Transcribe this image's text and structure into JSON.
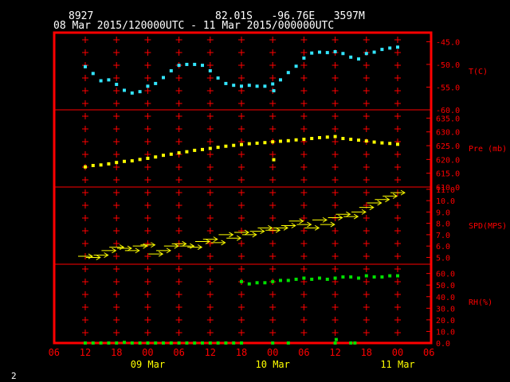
{
  "header": {
    "station": "8927",
    "location": "82.01S   -96.76E   3597M",
    "period": "08 Mar 2015/120000UTC - 11 Mar 2015/000000UTC"
  },
  "footer": {
    "page_number": "2"
  },
  "colors": {
    "background": "#000000",
    "frame": "#ff0000",
    "axis_text": "#ff0000",
    "header_text": "#ffffff",
    "date_text": "#ffff00",
    "temperature": "#33e5ff",
    "pressure": "#ffff00",
    "wind": "#ffff00",
    "humidity": "#00e000"
  },
  "x_axis": {
    "tick_labels": [
      "06",
      "12",
      "18",
      "00",
      "06",
      "12",
      "18",
      "00",
      "06",
      "12",
      "18",
      "00",
      "06"
    ],
    "tick_hours": [
      -6,
      0,
      6,
      12,
      18,
      24,
      30,
      36,
      42,
      48,
      54,
      60,
      66
    ],
    "date_labels": [
      {
        "text": "09 Mar",
        "hour": 12
      },
      {
        "text": "10 Mar",
        "hour": 36
      },
      {
        "text": "11 Mar",
        "hour": 60
      }
    ]
  },
  "chart_data": [
    {
      "type": "scatter",
      "panel": "temperature",
      "unit_label": "T(C)",
      "ylim": [
        -60,
        -43
      ],
      "y_ticks": [
        -45,
        -50,
        -55,
        -60
      ],
      "x_hours": [
        0,
        1.5,
        3,
        4.5,
        6,
        7.5,
        9,
        10.5,
        12,
        13.5,
        15,
        16.5,
        18,
        19.5,
        21,
        22.5,
        24,
        25.5,
        27,
        28.5,
        30,
        31.5,
        33,
        34.5,
        36,
        36.2,
        37.5,
        39,
        40.5,
        42,
        43.5,
        45,
        46.5,
        48,
        49.5,
        51,
        52.5,
        54,
        55.5,
        57,
        58.5,
        60
      ],
      "y": [
        -50.5,
        -52.0,
        -53.6,
        -53.4,
        -54.4,
        -55.7,
        -56.3,
        -56.0,
        -54.8,
        -54.2,
        -52.9,
        -51.4,
        -50.2,
        -50.0,
        -50.0,
        -50.2,
        -51.4,
        -53.0,
        -54.2,
        -54.6,
        -54.8,
        -54.6,
        -54.8,
        -54.8,
        -54.3,
        -55.8,
        -53.4,
        -51.8,
        -50.4,
        -48.6,
        -47.5,
        -47.3,
        -47.4,
        -47.2,
        -47.6,
        -48.4,
        -48.8,
        -47.6,
        -47.3,
        -46.7,
        -46.4,
        -46.2
      ]
    },
    {
      "type": "scatter",
      "panel": "pressure",
      "unit_label": "Pre (mb)",
      "ylim": [
        610,
        638
      ],
      "y_ticks": [
        635,
        630,
        625,
        620,
        615,
        610
      ],
      "x_hours": [
        0,
        1.5,
        3,
        4.5,
        6,
        7.5,
        9,
        10.5,
        12,
        13.5,
        15,
        16.5,
        18,
        19.5,
        21,
        22.5,
        24,
        25.5,
        27,
        28.5,
        30,
        31.5,
        33,
        34.5,
        36,
        36.2,
        37.5,
        39,
        40.5,
        42,
        43.5,
        45,
        46.5,
        48,
        49.5,
        51,
        52.5,
        54,
        55.5,
        57,
        58.5,
        60
      ],
      "y": [
        617.3,
        617.8,
        618.0,
        618.4,
        618.9,
        619.3,
        619.5,
        620.0,
        620.4,
        620.9,
        621.5,
        621.9,
        622.4,
        622.8,
        623.3,
        623.6,
        624.0,
        624.4,
        624.8,
        625.1,
        625.4,
        625.7,
        625.9,
        626.1,
        626.4,
        619.9,
        626.6,
        626.8,
        627.1,
        627.3,
        627.6,
        627.9,
        628.1,
        628.3,
        627.6,
        627.3,
        627.0,
        626.7,
        626.3,
        626.0,
        625.8,
        625.5
      ]
    },
    {
      "type": "wind",
      "panel": "wind_speed",
      "unit_label": "SPD(MPS)",
      "ylim": [
        4.4,
        11.2
      ],
      "y_ticks": [
        11,
        10,
        9,
        8,
        7,
        6,
        5
      ],
      "x_hours": [
        0,
        1.5,
        3,
        4.5,
        6,
        7.5,
        9,
        10.5,
        12,
        13.5,
        15,
        16.5,
        18,
        19.5,
        21,
        22.5,
        24,
        25.5,
        27,
        28.5,
        30,
        31.5,
        33,
        34.5,
        36,
        37.5,
        39,
        40.5,
        42,
        43.5,
        45,
        46.5,
        48,
        49.5,
        51,
        52.5,
        54,
        55.5,
        57,
        58.5,
        60
      ],
      "y": [
        5.1,
        5.0,
        5.2,
        5.6,
        5.9,
        5.8,
        5.6,
        6.0,
        6.1,
        5.3,
        5.6,
        6.0,
        6.2,
        6.0,
        5.9,
        6.4,
        6.6,
        6.3,
        7.0,
        6.7,
        7.2,
        7.0,
        7.3,
        7.6,
        7.4,
        7.6,
        7.8,
        8.2,
        7.9,
        7.6,
        8.3,
        7.9,
        8.5,
        8.8,
        8.6,
        9.0,
        9.4,
        9.8,
        10.1,
        10.4,
        10.7
      ]
    },
    {
      "type": "scatter",
      "panel": "humidity",
      "unit_label": "RH(%)",
      "ylim": [
        0,
        68
      ],
      "y_ticks": [
        60,
        50,
        40,
        30,
        20,
        10,
        0
      ],
      "x_hours": [
        30,
        31.5,
        33,
        34.5,
        36,
        37.5,
        39,
        40.5,
        42,
        43.5,
        45,
        46.5,
        48,
        49.5,
        51,
        52.5,
        54,
        55.5,
        57,
        58.5,
        60
      ],
      "y": [
        53,
        51,
        52,
        52,
        53,
        54,
        54,
        55,
        56,
        55,
        56,
        55,
        56,
        57,
        57,
        56,
        58,
        57,
        57,
        58,
        58
      ]
    },
    {
      "type": "scatter",
      "panel": "humidity_baseline",
      "ylim": [
        0,
        68
      ],
      "x_hours": [
        0,
        1.5,
        3,
        4.5,
        6,
        7.5,
        9,
        10.5,
        12,
        13.5,
        15,
        16.5,
        18,
        19.5,
        21,
        22.5,
        24,
        25.5,
        27,
        28.5,
        30,
        36,
        39,
        48,
        48.2,
        51,
        51.8
      ],
      "y": [
        0,
        0,
        0,
        0,
        0,
        0.5,
        0,
        0,
        0,
        0,
        0,
        0,
        0,
        0,
        0,
        0,
        0,
        0,
        0,
        0,
        0,
        0,
        0,
        0,
        3,
        0,
        0
      ]
    }
  ]
}
